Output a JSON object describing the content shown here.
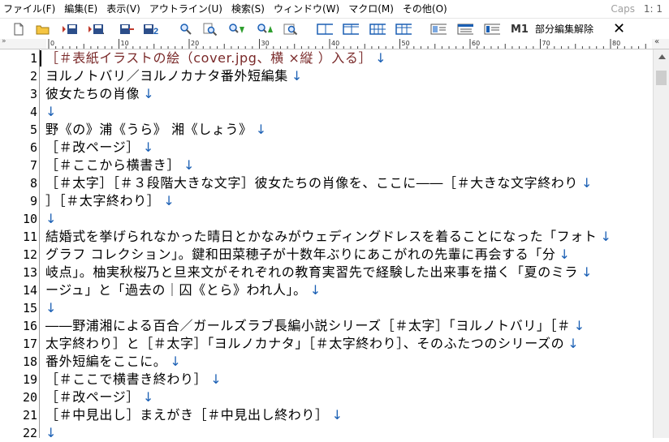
{
  "menu": {
    "items": [
      "ファイル(F)",
      "編集(E)",
      "表示(V)",
      "アウトライン(U)",
      "検索(S)",
      "ウィンドウ(W)",
      "マクロ(M)",
      "その他(O)"
    ],
    "caps": "Caps",
    "position": "1: 1"
  },
  "toolbar": {
    "icons": [
      "new-file-icon",
      "open-folder-icon",
      "save-all-icon",
      "save-as-icon",
      "export-icon",
      "reload-icon",
      "search-icon",
      "find-text-icon",
      "find-next-icon",
      "find-previous-icon",
      "replace-icon",
      "layout-single-icon",
      "layout-split-icon",
      "layout-grid-icon",
      "layout-columns-icon",
      "window-icon",
      "window-alt-icon",
      "panel-icon",
      "macro-icon"
    ],
    "macro_label": "M1",
    "partial_edit_release": "部分編集解除",
    "close_symbol": "✕"
  },
  "ruler": {
    "marker_left": "»",
    "ticks": [
      "0",
      "10",
      "20",
      "30",
      "40",
      "50",
      "60",
      "70",
      "80"
    ],
    "marker_end": "«"
  },
  "editor": {
    "lines": [
      {
        "n": "1",
        "text": "［＃表紙イラストの絵（cover.jpg、横      ×縦      ）入る］",
        "tag": true
      },
      {
        "n": "2",
        "text": "ヨルノトバリ／ヨルノカナタ番外短編集"
      },
      {
        "n": "3",
        "text": "彼女たちの肖像"
      },
      {
        "n": "4",
        "text": ""
      },
      {
        "n": "5",
        "text": "野《の》浦《うら》 湘《しょう》"
      },
      {
        "n": "6",
        "text": "［＃改ページ］"
      },
      {
        "n": "7",
        "text": "［＃ここから横書き］"
      },
      {
        "n": "8",
        "text": "［＃太字］［＃３段階大きな文字］彼女たちの肖像を、ここに――［＃大きな文字終わり"
      },
      {
        "n": "9",
        "text": "］［＃太字終わり］"
      },
      {
        "n": "10",
        "text": ""
      },
      {
        "n": "11",
        "text": "結婚式を挙げられなかった晴日とかなみがウェディングドレスを着ることになった「フォト"
      },
      {
        "n": "12",
        "text": "グラフ コレクション」。鍵和田菜穂子が十数年ぶりにあこがれの先輩に再会する「分"
      },
      {
        "n": "13",
        "text": "岐点」。柚実秋桜乃と旦来文がそれぞれの教育実習先で経験した出来事を描く「夏のミラ"
      },
      {
        "n": "14",
        "text": "ージュ」と「過去の｜囚《とら》われ人」。"
      },
      {
        "n": "15",
        "text": ""
      },
      {
        "n": "16",
        "text": "――野浦湘による百合／ガールズラブ長編小説シリーズ［＃太字］「ヨルノトバリ」［＃"
      },
      {
        "n": "17",
        "text": "太字終わり］と［＃太字］「ヨルノカナタ」［＃太字終わり］、そのふたつのシリーズの"
      },
      {
        "n": "18",
        "text": "番外短編をここに。"
      },
      {
        "n": "19",
        "text": "［＃ここで横書き終わり］"
      },
      {
        "n": "20",
        "text": "［＃改ページ］"
      },
      {
        "n": "21",
        "text": "［＃中見出し］まえがき［＃中見出し終わり］"
      },
      {
        "n": "22",
        "text": ""
      }
    ],
    "linefeed_symbol": "↓"
  },
  "colors": {
    "linefeed": "#1a5fb4",
    "tag_text": "#7a2a2a",
    "caps_text": "#a0a0a0"
  }
}
